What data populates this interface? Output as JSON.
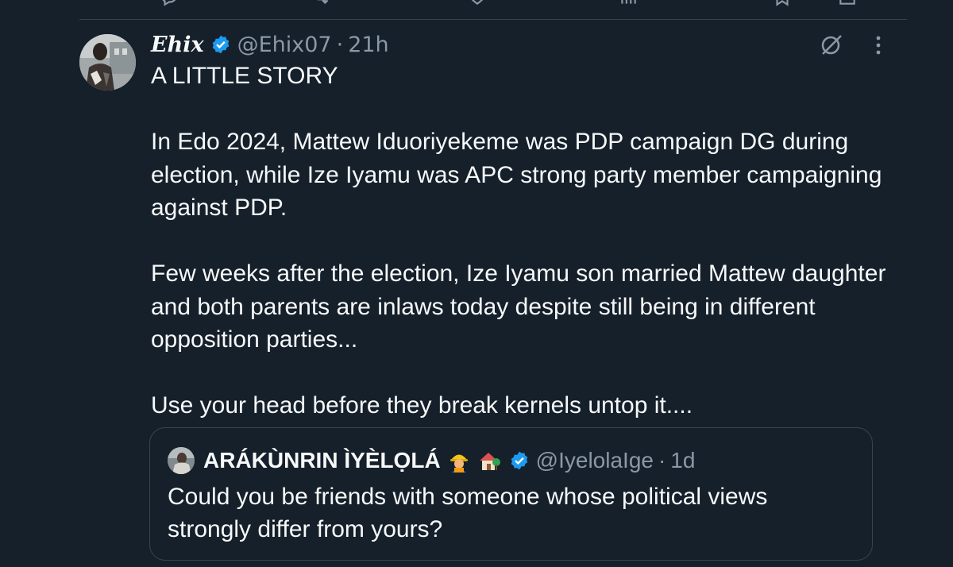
{
  "previous_tweet": {
    "actions": [
      {
        "name": "reply",
        "icon": "reply-icon",
        "count": ""
      },
      {
        "name": "repost",
        "icon": "repost-icon",
        "count": ""
      },
      {
        "name": "like",
        "icon": "heart-icon",
        "count": ""
      },
      {
        "name": "views",
        "icon": "views-icon",
        "count": ""
      },
      {
        "name": "bookmark",
        "icon": "bookmark-icon",
        "count": ""
      },
      {
        "name": "share",
        "icon": "share-icon",
        "count": ""
      }
    ]
  },
  "tweet": {
    "display_name": "Ehix",
    "verified": true,
    "handle": "@Ehix07",
    "separator": "·",
    "time": "21h",
    "paragraphs": [
      "A LITTLE STORY",
      "In Edo 2024, Mattew Iduoriyekeme was PDP campaign DG during election, while Ize Iyamu was APC strong party member campaigning against PDP.",
      "Few weeks after the election, Ize Iyamu son married Mattew daughter and both parents are inlaws today despite still being in different opposition parties...",
      "Use your head before they break kernels untop it...."
    ]
  },
  "quoted_tweet": {
    "display_name": "ARÁKÙNRIN ÌYÈLỌLÁ",
    "emojis": [
      "construction-worker-emoji",
      "house-with-garden-emoji"
    ],
    "verified": true,
    "handle": "@IyelolaIge",
    "separator": "·",
    "time": "1d",
    "text": "Could you be friends with someone whose political views strongly differ from yours?"
  },
  "icons": {
    "verified": "verified-badge-icon",
    "grok": "grok-icon",
    "more": "more-options-icon"
  },
  "colors": {
    "background": "#15202b",
    "text_primary": "#f7f9f9",
    "text_secondary": "#8b98a5",
    "border": "#38444d",
    "verified_blue": "#1d9bf0"
  }
}
